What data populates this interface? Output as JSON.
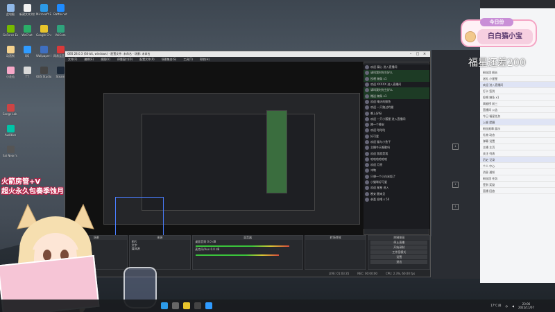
{
  "desktop": {
    "icons": [
      {
        "label": "此电脑",
        "color": "#8fb8e8"
      },
      {
        "label": "GeForce Experience",
        "color": "#76b900"
      },
      {
        "label": "动画制",
        "color": "#f4d28e"
      },
      {
        "label": "小花仙",
        "color": "#f7a8c8"
      },
      {
        "label": "新建文本文档",
        "color": "#f2f2f2"
      },
      {
        "label": "WeChat",
        "color": "#2aae67"
      },
      {
        "label": "QQ",
        "color": "#2f9bff"
      },
      {
        "label": "TT",
        "color": "#d9d9d9"
      },
      {
        "label": "Microsoft Edge",
        "color": "#2c9ae8"
      },
      {
        "label": "Google Chrome",
        "color": "#e8c52c"
      },
      {
        "label": "Wallpaper Engine",
        "color": "#3f6fbf"
      },
      {
        "label": "OBS Studio",
        "color": "#444"
      },
      {
        "label": "Battle.net",
        "color": "#1e8bff"
      },
      {
        "label": "VeiCam",
        "color": "#2fa37c"
      },
      {
        "label": "网易云音乐",
        "color": "#d83a3a"
      },
      {
        "label": "Steam",
        "color": "#1b2838"
      },
      {
        "label": "Songs Lab Music Pro",
        "color": "#c44"
      },
      {
        "label": "Audition",
        "color": "#00c4a7"
      },
      {
        "label": "Sai Neon's Cafe",
        "color": "#555"
      }
    ]
  },
  "obs": {
    "title": "OBS 28.0.3 (64-bit, windows) - 配置文件: 未命名 - 场景: 未命名",
    "menu": [
      "文件(F)",
      "编辑(E)",
      "视图(V)",
      "停靠窗口(D)",
      "配置文件(P)",
      "场景集合(S)",
      "工具(T)",
      "帮助(H)"
    ],
    "docks": {
      "scenes": "场景",
      "sources": "来源",
      "mixer": "混音器",
      "transitions": "转场特效",
      "controls": "控制按钮"
    },
    "sources_list": [
      "图片",
      "文字",
      "媒体源"
    ],
    "mixer_channels": [
      {
        "name": "桌面音频",
        "db": "0.0 dB"
      },
      {
        "name": "麦克风/Aux",
        "db": "0.0 dB"
      }
    ],
    "control_buttons": [
      "停止直播",
      "开始录制",
      "工作室模式",
      "设置",
      "退出"
    ],
    "status": [
      "LIVE: 01:03:35",
      "REC: 00:00:00",
      "CPU: 2.3%, 60.00 fps"
    ]
  },
  "chat": {
    "messages": [
      {
        "text": "欢迎 凝心 进入直播间",
        "gift": false
      },
      {
        "text": "请叫我时先生好么",
        "gift": true
      },
      {
        "text": "投喂 辣条 x1",
        "gift": true
      },
      {
        "text": "欢迎 XXXXX 进入直播间",
        "gift": false
      },
      {
        "text": "请叫我时先生好么",
        "gift": true
      },
      {
        "text": "赠送 辣条 x1",
        "gift": true
      },
      {
        "text": "欢迎 晴天的鲸鱼",
        "gift": false
      },
      {
        "text": "欢迎 一只路过的猫",
        "gift": false
      },
      {
        "text": "晚上好呀",
        "gift": false
      },
      {
        "text": "欢迎 一只小狐狸 进入直播间",
        "gift": false
      },
      {
        "text": "蹲一个晚安",
        "gift": false
      },
      {
        "text": "欢迎 咕咕咕",
        "gift": false
      },
      {
        "text": "好可爱",
        "gift": false
      },
      {
        "text": "欢迎 猫与小鱼干",
        "gift": false
      },
      {
        "text": "主播今天唱歌吗",
        "gift": false
      },
      {
        "text": "欢迎 我就是我",
        "gift": false
      },
      {
        "text": "哈哈哈哈哈哈",
        "gift": false
      },
      {
        "text": "欢迎 月亮",
        "gift": false
      },
      {
        "text": "冲鸭",
        "gift": false
      },
      {
        "text": "只想一个小白米饭了",
        "gift": false
      },
      {
        "text": "小猫咪好可爱",
        "gift": false
      },
      {
        "text": "欢迎 星星 进入",
        "gift": false
      },
      {
        "text": "晚安 醒来见",
        "gift": false
      },
      {
        "text": "恭喜 投喂 x 50",
        "gift": false
      }
    ]
  },
  "overlay": {
    "badge_top": "今日份",
    "badge_main": "白白猫小宝",
    "fortune": "福星还差200",
    "caption_line1": "火箭房管+V",
    "caption_line2": "超火永久包奏季蚀月"
  },
  "bili": {
    "rows": [
      "粉丝团 舰长",
      "送礼 小星星",
      "欢迎 进入直播间",
      "打卡 签到",
      "投喂 辣条 x1",
      "高能榜 前三",
      "直播间 公告",
      "今日 福星任务",
      "上舰 提醒",
      "粉丝勋章 展示",
      "礼物 动态",
      "弹幕 设置",
      "主播 主页",
      "关注 列表",
      "历史 记录",
      "个人 中心",
      "消息 通知",
      "粉丝团 任务",
      "签到 奖励",
      "直播 回放"
    ]
  },
  "taskbar": {
    "time": "23:06",
    "date": "2022/11/07",
    "temp": "17°C 阴"
  }
}
